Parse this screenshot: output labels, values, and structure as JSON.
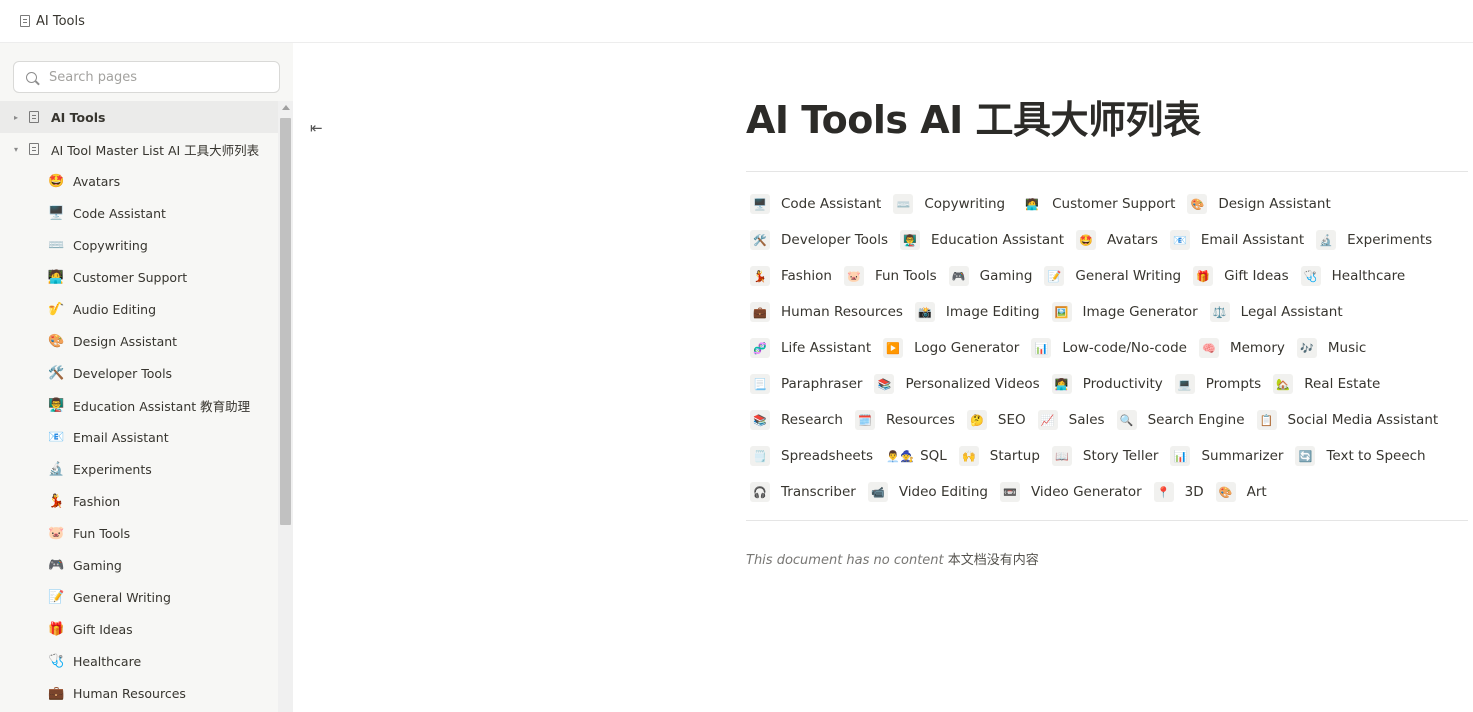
{
  "topbar": {
    "title": "AI Tools"
  },
  "search": {
    "placeholder": "Search pages"
  },
  "sidebar": {
    "items": [
      {
        "label": "AI Tools",
        "type": "page",
        "caret": "▸",
        "active": true
      },
      {
        "label": "AI Tool Master List AI 工具大师列表",
        "type": "page",
        "caret": "▾"
      },
      {
        "label": "Avatars",
        "emoji": "🤩"
      },
      {
        "label": "Code Assistant",
        "emoji": "🖥️"
      },
      {
        "label": "Copywriting",
        "emoji": "⌨️"
      },
      {
        "label": "Customer Support",
        "emoji": "🧑‍💻",
        "wide": true
      },
      {
        "label": "Audio Editing",
        "emoji": "🎷"
      },
      {
        "label": "Design Assistant",
        "emoji": "🎨"
      },
      {
        "label": "Developer Tools",
        "emoji": "🛠️"
      },
      {
        "label": "Education Assistant 教育助理",
        "emoji": "👨‍🏫"
      },
      {
        "label": "Email Assistant",
        "emoji": "📧"
      },
      {
        "label": "Experiments",
        "emoji": "🔬"
      },
      {
        "label": "Fashion",
        "emoji": "💃"
      },
      {
        "label": "Fun Tools",
        "emoji": "🐷"
      },
      {
        "label": "Gaming",
        "emoji": "🎮"
      },
      {
        "label": "General Writing",
        "emoji": "📝"
      },
      {
        "label": "Gift Ideas",
        "emoji": "🎁"
      },
      {
        "label": "Healthcare",
        "emoji": "🩺"
      },
      {
        "label": "Human Resources",
        "emoji": "💼"
      }
    ]
  },
  "main": {
    "title": "AI Tools AI 工具大师列表",
    "empty_note": "This document has no content",
    "empty_note_zh": "本文档没有内容",
    "chip_rows": [
      [
        {
          "e": "🖥️",
          "l": "Code Assistant"
        },
        {
          "e": "⌨️",
          "l": "Copywriting"
        },
        {
          "e": "🧑‍💻",
          "l": "Customer Support",
          "plain": true
        },
        {
          "e": "🎨",
          "l": "Design Assistant"
        }
      ],
      [
        {
          "e": "🛠️",
          "l": "Developer Tools"
        },
        {
          "e": "👨‍🏫",
          "l": "Education Assistant"
        },
        {
          "e": "🤩",
          "l": "Avatars"
        },
        {
          "e": "📧",
          "l": "Email Assistant"
        },
        {
          "e": "🔬",
          "l": "Experiments"
        }
      ],
      [
        {
          "e": "💃",
          "l": "Fashion"
        },
        {
          "e": "🐷",
          "l": "Fun Tools"
        },
        {
          "e": "🎮",
          "l": "Gaming"
        },
        {
          "e": "📝",
          "l": "General Writing"
        },
        {
          "e": "🎁",
          "l": "Gift Ideas"
        },
        {
          "e": "🩺",
          "l": "Healthcare"
        }
      ],
      [
        {
          "e": "💼",
          "l": "Human Resources"
        },
        {
          "e": "📸",
          "l": "Image Editing"
        },
        {
          "e": "🖼️",
          "l": "Image Generator"
        },
        {
          "e": "⚖️",
          "l": "Legal Assistant"
        }
      ],
      [
        {
          "e": "🧬",
          "l": "Life Assistant"
        },
        {
          "e": "▶️",
          "l": "Logo Generator"
        },
        {
          "e": "📊",
          "l": "Low-code/No-code"
        },
        {
          "e": "🧠",
          "l": "Memory"
        },
        {
          "e": "🎶",
          "l": "Music"
        }
      ],
      [
        {
          "e": "📃",
          "l": "Paraphraser"
        },
        {
          "e": "📚",
          "l": "Personalized Videos"
        },
        {
          "e": "👩‍💻",
          "l": "Productivity"
        },
        {
          "e": "💻",
          "l": "Prompts"
        },
        {
          "e": "🏡",
          "l": "Real Estate"
        }
      ],
      [
        {
          "e": "📚",
          "l": "Research"
        },
        {
          "e": "🗓️",
          "l": "Resources"
        },
        {
          "e": "🤔",
          "l": "SEO"
        },
        {
          "e": "📈",
          "l": "Sales"
        },
        {
          "e": "🔍",
          "l": "Search Engine"
        },
        {
          "e": "📋",
          "l": "Social Media Assistant"
        }
      ],
      [
        {
          "e": "🗒️",
          "l": "Spreadsheets"
        },
        {
          "e": "👨‍💼🧙",
          "l": "SQL",
          "plain": true
        },
        {
          "e": "🙌",
          "l": "Startup"
        },
        {
          "e": "📖",
          "l": "Story Teller"
        },
        {
          "e": "📊",
          "l": "Summarizer"
        },
        {
          "e": "🔄",
          "l": "Text to Speech"
        }
      ],
      [
        {
          "e": "🎧",
          "l": "Transcriber"
        },
        {
          "e": "📹",
          "l": "Video Editing"
        },
        {
          "e": "📼",
          "l": "Video Generator"
        },
        {
          "e": "📍",
          "l": "3D"
        },
        {
          "e": "🎨",
          "l": "Art"
        }
      ]
    ]
  }
}
